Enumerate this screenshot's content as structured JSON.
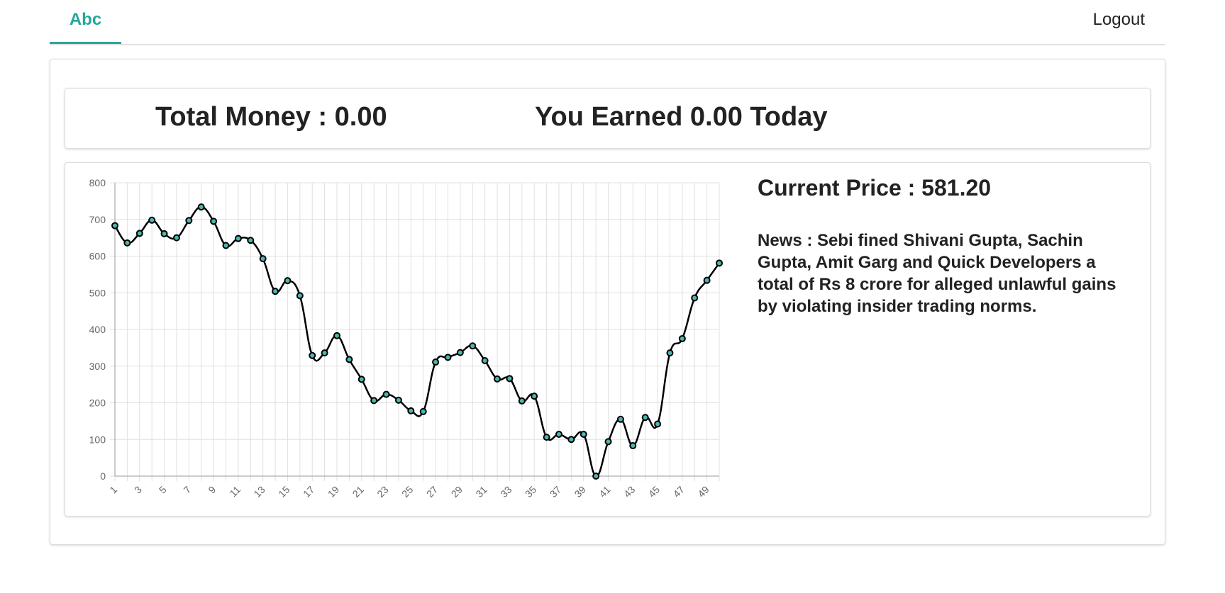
{
  "nav": {
    "tab_label": "Abc",
    "logout_label": "Logout"
  },
  "stats": {
    "total_money": "Total Money : 0.00",
    "earned_today": "You Earned 0.00 Today"
  },
  "info": {
    "current_price": "Current Price : 581.20",
    "news": "News : Sebi fined Shivani Gupta, Sachin Gupta, Amit Garg and Quick Developers a total of Rs 8 crore for alleged unlawful gains by violating insider trading norms."
  },
  "colors": {
    "accent": "#26a69a",
    "line": "#000000",
    "point_fill": "#4db6ac",
    "grid": "#e0e0e0"
  },
  "chart_data": {
    "type": "line",
    "title": "",
    "xlabel": "",
    "ylabel": "",
    "ylim": [
      0,
      800
    ],
    "yticks": [
      0,
      100,
      200,
      300,
      400,
      500,
      600,
      700,
      800
    ],
    "x": [
      1,
      2,
      3,
      4,
      5,
      6,
      7,
      8,
      9,
      10,
      11,
      12,
      13,
      14,
      15,
      16,
      17,
      18,
      19,
      20,
      21,
      22,
      23,
      24,
      25,
      26,
      27,
      28,
      29,
      30,
      31,
      32,
      33,
      34,
      35,
      36,
      37,
      38,
      39,
      40,
      41,
      42,
      43,
      44,
      45,
      46,
      47,
      48,
      49,
      50
    ],
    "xtick_labels": [
      "1",
      "3",
      "5",
      "7",
      "9",
      "11",
      "13",
      "15",
      "17",
      "19",
      "21",
      "23",
      "25",
      "27",
      "29",
      "31",
      "33",
      "35",
      "37",
      "39",
      "41",
      "43",
      "45",
      "47",
      "49"
    ],
    "grid": true,
    "legend": "none",
    "series": [
      {
        "values": [
          683,
          636,
          662,
          698,
          661,
          650,
          697,
          734,
          695,
          629,
          648,
          643,
          593,
          504,
          533,
          492,
          329,
          336,
          383,
          318,
          264,
          206,
          223,
          207,
          178,
          176,
          311,
          324,
          337,
          355,
          315,
          265,
          266,
          205,
          218,
          106,
          114,
          100,
          114,
          0,
          94,
          155,
          83,
          160,
          142,
          336,
          375,
          486,
          534,
          581
        ]
      }
    ]
  }
}
